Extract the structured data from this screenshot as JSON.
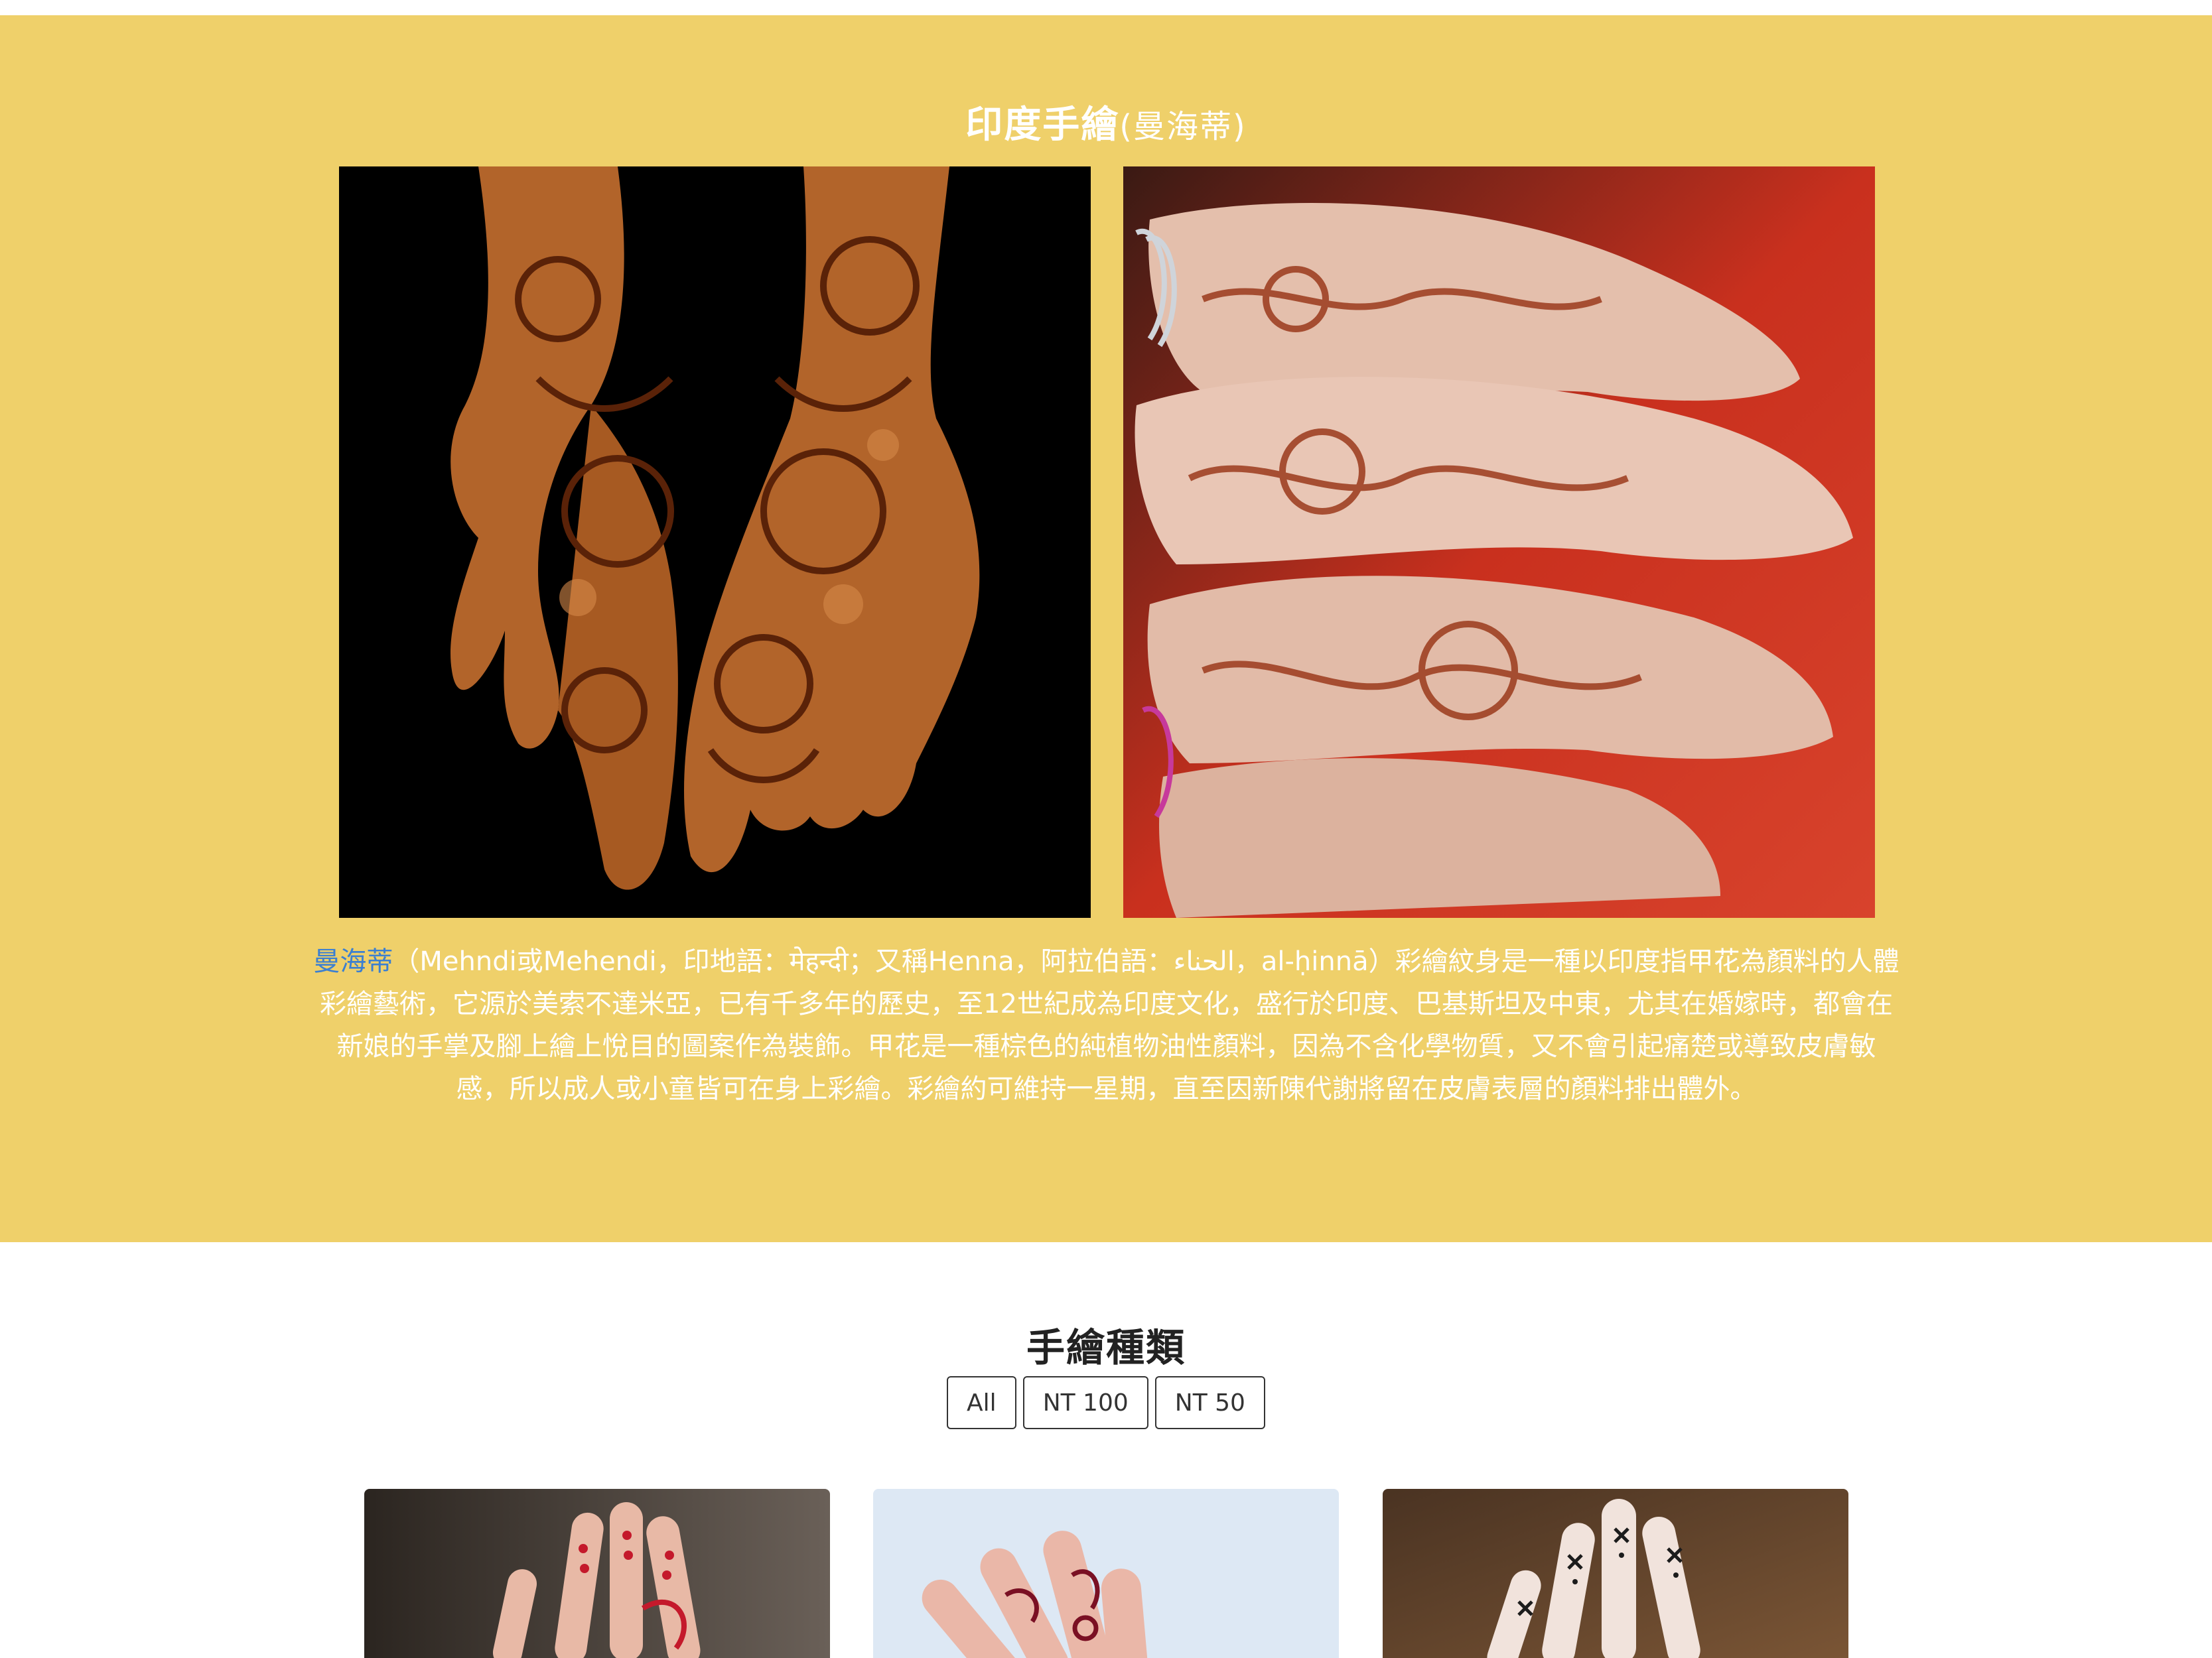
{
  "hero": {
    "title": "印度手繪",
    "title_sub": "(曼海蒂)",
    "desc_lead": "曼海蒂",
    "desc_body": "（Mehndi或Mehendi，印地語：मेहन्दी；又稱Henna，阿拉伯語：الحناء，al-ḥinnā）彩繪紋身是一種以印度指甲花為顏料的人體彩繪藝術，它源於美索不達米亞，已有千多年的歷史，至12世紀成為印度文化，盛行於印度、巴基斯坦及中東，尤其在婚嫁時，都會在新娘的手掌及腳上繪上悅目的圖案作為裝飾。甲花是一種棕色的純植物油性顏料，因為不含化學物質，又不會引起痛楚或導致皮膚敏感，所以成人或小童皆可在身上彩繪。彩繪約可維持一星期，直至因新陳代謝將留在皮膚表層的顏料排出體外。",
    "photos": [
      {
        "name": "hands-henna-black-background"
      },
      {
        "name": "hands-henna-red-background"
      }
    ]
  },
  "section": {
    "title": "手繪種類",
    "filters": [
      "All",
      "NT 100",
      "NT 50"
    ]
  },
  "cards": [
    {
      "name": "red-finger-henna"
    },
    {
      "name": "maroon-hand-henna"
    },
    {
      "name": "black-finger-henna"
    }
  ],
  "colors": {
    "hero_bg": "#efd06a",
    "link": "#3b7fd1"
  }
}
